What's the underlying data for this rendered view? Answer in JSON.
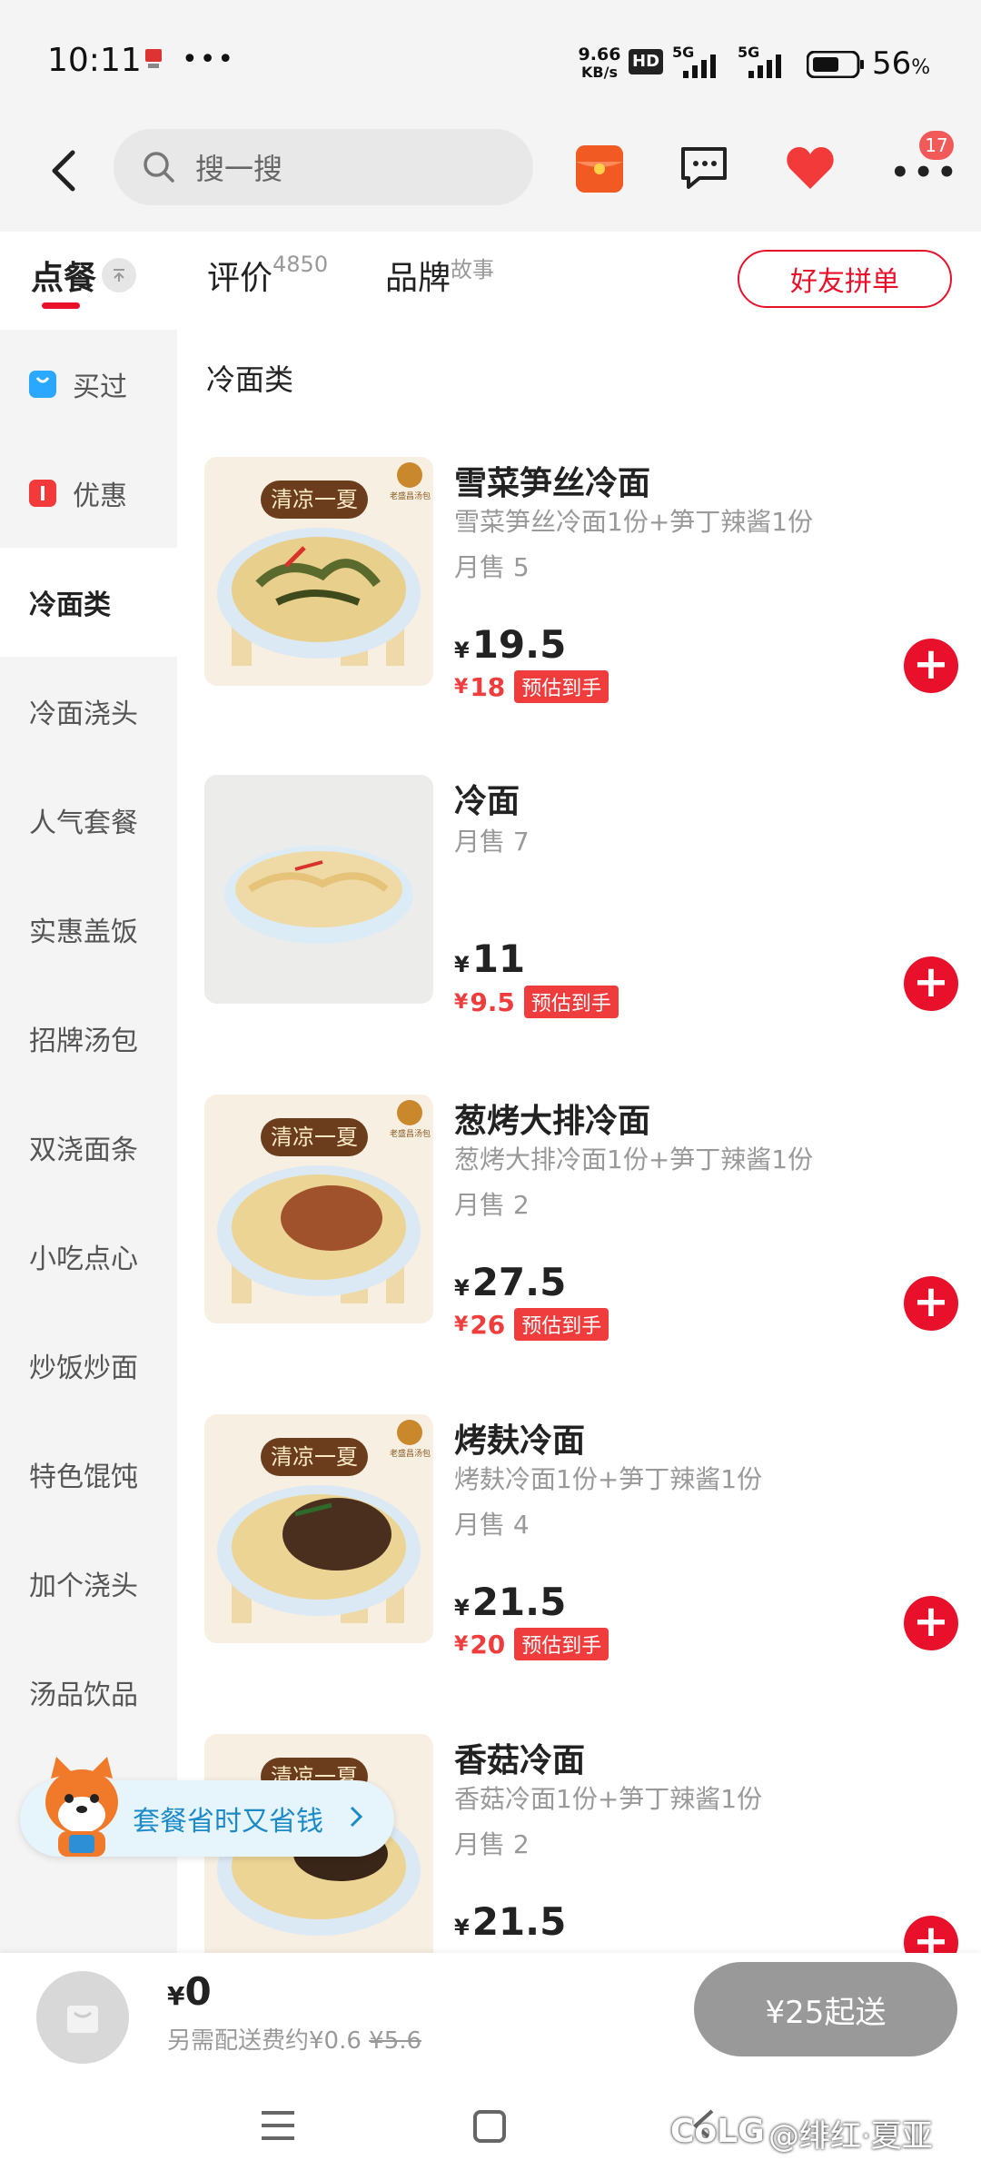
{
  "status": {
    "time": "10:11",
    "net_speed_value": "9.66",
    "net_speed_unit": "KB/s",
    "hd": "HD",
    "sig1": "5G",
    "sig2": "5G",
    "battery": "56",
    "battery_unit": "%"
  },
  "header": {
    "search_placeholder": "搜一搜",
    "notif_count": "17"
  },
  "tabs": {
    "order": "点餐",
    "review": "评价",
    "review_count": "4850",
    "brand": "品牌",
    "brand_sub": "故事",
    "group_order": "好友拼单"
  },
  "sidebar": {
    "items": [
      {
        "label": "买过"
      },
      {
        "label": "优惠"
      },
      {
        "label": "冷面类"
      },
      {
        "label": "冷面浇头"
      },
      {
        "label": "人气套餐"
      },
      {
        "label": "实惠盖饭"
      },
      {
        "label": "招牌汤包"
      },
      {
        "label": "双浇面条"
      },
      {
        "label": "小吃点心"
      },
      {
        "label": "炒饭炒面"
      },
      {
        "label": "特色馄饨"
      },
      {
        "label": "加个浇头"
      },
      {
        "label": "汤品饮品"
      }
    ]
  },
  "section_title": "冷面类",
  "promo_banner": "套餐省时又省钱",
  "products": [
    {
      "name": "雪菜笋丝冷面",
      "desc": "雪菜笋丝冷面1份+笋丁辣酱1份",
      "sales": "月售 5",
      "price": "19.5",
      "est": "18",
      "est_label": "预估到手",
      "banner": "清凉一夏",
      "brand": "老盛昌汤包"
    },
    {
      "name": "冷面",
      "desc": "",
      "sales": "月售 7",
      "price": "11",
      "est": "9.5",
      "est_label": "预估到手",
      "banner": "",
      "brand": ""
    },
    {
      "name": "葱烤大排冷面",
      "desc": "葱烤大排冷面1份+笋丁辣酱1份",
      "sales": "月售 2",
      "price": "27.5",
      "est": "26",
      "est_label": "预估到手",
      "banner": "清凉一夏",
      "brand": "老盛昌汤包"
    },
    {
      "name": "烤麸冷面",
      "desc": "烤麸冷面1份+笋丁辣酱1份",
      "sales": "月售 4",
      "price": "21.5",
      "est": "20",
      "est_label": "预估到手",
      "banner": "清凉一夏",
      "brand": "老盛昌汤包"
    },
    {
      "name": "香菇冷面",
      "desc": "香菇冷面1份+笋丁辣酱1份",
      "sales": "月售 2",
      "price": "21.5",
      "est": "",
      "est_label": "",
      "banner": "清凉一夏",
      "brand": ""
    }
  ],
  "currency": "¥",
  "cart": {
    "total": "0",
    "fee_text": "另需配送费约¥0.6",
    "fee_original": "¥5.6",
    "min_order": "¥25起送"
  },
  "watermark": "@绯红·夏亚",
  "colors": {
    "accent": "#e8102a",
    "price_red": "#ef3c3c"
  }
}
